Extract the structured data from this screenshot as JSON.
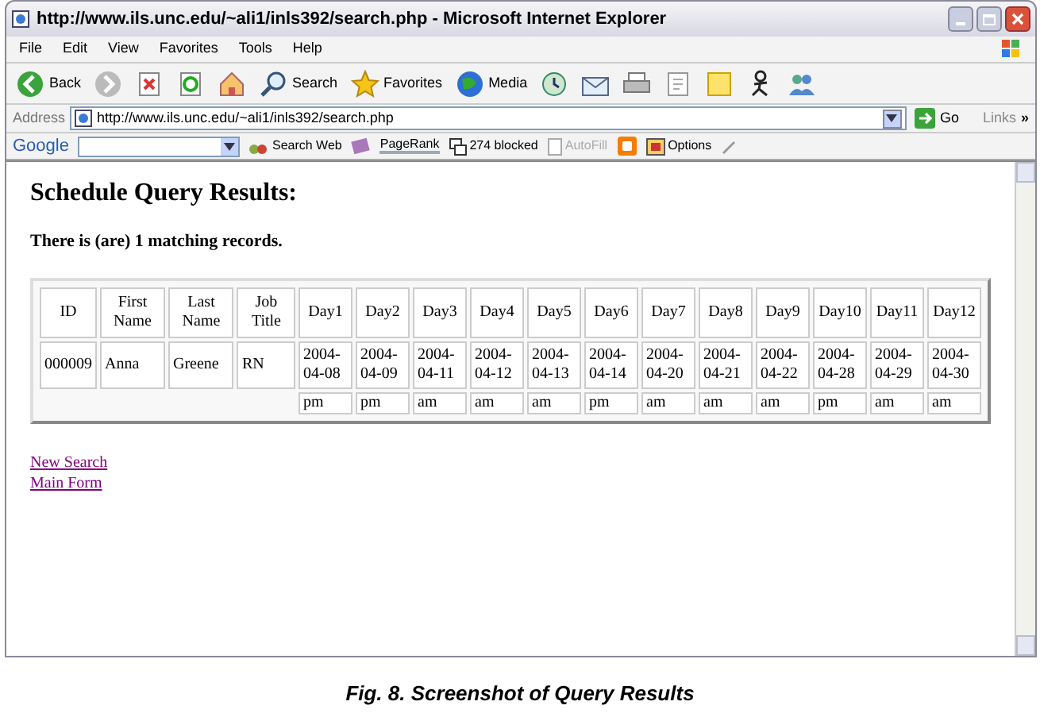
{
  "window": {
    "title": "http://www.ils.unc.edu/~ali1/inls392/search.php - Microsoft Internet Explorer"
  },
  "menu": [
    "File",
    "Edit",
    "View",
    "Favorites",
    "Tools",
    "Help"
  ],
  "toolbar": [
    {
      "kind": "back",
      "label": "Back"
    },
    {
      "kind": "forward"
    },
    {
      "kind": "stop"
    },
    {
      "kind": "refresh"
    },
    {
      "kind": "home"
    },
    {
      "kind": "search",
      "label": "Search"
    },
    {
      "kind": "favorites",
      "label": "Favorites"
    },
    {
      "kind": "media",
      "label": "Media"
    },
    {
      "kind": "history"
    },
    {
      "kind": "mail"
    },
    {
      "kind": "print"
    },
    {
      "kind": "edit"
    },
    {
      "kind": "note"
    },
    {
      "kind": "messenger"
    },
    {
      "kind": "people"
    }
  ],
  "address": {
    "label": "Address",
    "value": "http://www.ils.unc.edu/~ali1/inls392/search.php",
    "go": "Go",
    "links": "Links",
    "more": "»"
  },
  "google_bar": {
    "logo": "Google",
    "search_web": "Search Web",
    "pagerank": "PageRank",
    "blocked": "274 blocked",
    "autofill": "AutoFill",
    "autofill_disabled": true,
    "options": "Options"
  },
  "page": {
    "heading": "Schedule Query Results:",
    "summary": "There is (are) 1 matching records.",
    "table": {
      "columns": [
        "ID",
        "First Name",
        "Last Name",
        "Job Title",
        "Day1",
        "Day2",
        "Day3",
        "Day4",
        "Day5",
        "Day6",
        "Day7",
        "Day8",
        "Day9",
        "Day10",
        "Day11",
        "Day12"
      ],
      "rows": [
        [
          "000009",
          "Anna",
          "Greene",
          "RN",
          "2004-04-08",
          "2004-04-09",
          "2004-04-11",
          "2004-04-12",
          "2004-04-13",
          "2004-04-14",
          "2004-04-20",
          "2004-04-21",
          "2004-04-22",
          "2004-04-28",
          "2004-04-29",
          "2004-04-30"
        ]
      ],
      "shifts": [
        "pm",
        "pm",
        "am",
        "am",
        "am",
        "pm",
        "am",
        "am",
        "am",
        "pm",
        "am",
        "am"
      ]
    },
    "links": [
      "New Search",
      "Main Form"
    ]
  },
  "caption": "Fig. 8.  Screenshot of Query Results"
}
